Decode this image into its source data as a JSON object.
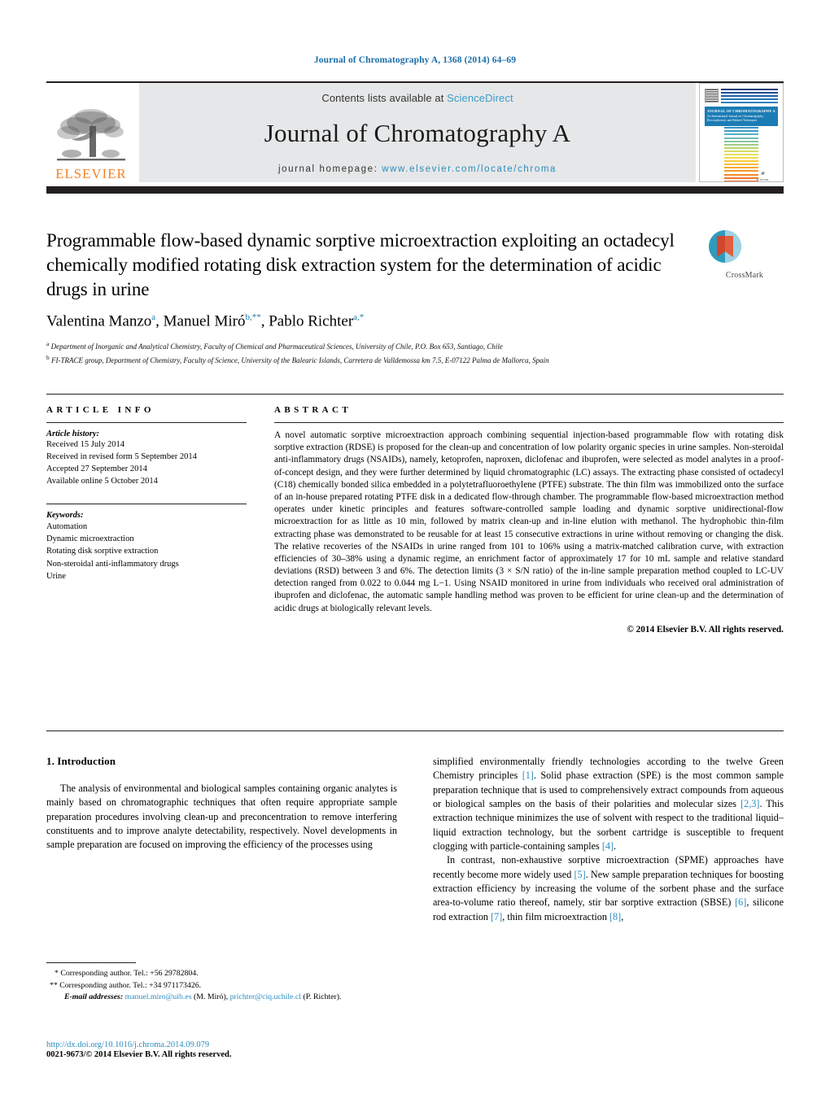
{
  "running_head": "Journal of Chromatography A, 1368 (2014) 64–69",
  "masthead": {
    "contents_prefix": "Contents lists available at ",
    "sciencedirect": "ScienceDirect",
    "journal_title": "Journal of Chromatography A",
    "homepage_prefix": "journal homepage: ",
    "homepage_url": "www.elsevier.com/locate/chroma",
    "publisher_wordmark": "ELSEVIER",
    "cover": {
      "band_title": "JOURNAL OF CHROMATOGRAPHY A",
      "band_sub": "An International Journal on Chromatography, Electrophoresis and Related Techniques",
      "publisher_note": "ELSEVIER"
    },
    "colors": {
      "link": "#2b8cbe",
      "elsevier_orange": "#f57f20",
      "masthead_grey": "#e6e7e8",
      "dark_band": "#231f20",
      "cover_band_blue": "#1b7cb5"
    }
  },
  "article": {
    "title": "Programmable flow-based dynamic sorptive microextraction exploiting an octadecyl chemically modified rotating disk extraction system for the determination of acidic drugs in urine",
    "authors": [
      {
        "name": "Valentina Manzo",
        "sup": "a"
      },
      {
        "name": "Manuel Miró",
        "sup": "b,**"
      },
      {
        "name": "Pablo Richter",
        "sup": "a,*"
      }
    ],
    "authors_line": "Valentina Manzo a, Manuel Miró b,**, Pablo Richter a,*",
    "affiliations": [
      {
        "marker": "a",
        "text": "Department of Inorganic and Analytical Chemistry, Faculty of Chemical and Pharmaceutical Sciences, University of Chile, P.O. Box 653, Santiago, Chile"
      },
      {
        "marker": "b",
        "text": "FI-TRACE group, Department of Chemistry, Faculty of Science, University of the Balearic Islands, Carretera de Valldemossa km 7.5, E-07122 Palma de Mallorca, Spain"
      }
    ],
    "crossmark_label": "CrossMark"
  },
  "article_info": {
    "heading": "ARTICLE INFO",
    "history_label": "Article history:",
    "history": [
      "Received 15 July 2014",
      "Received in revised form 5 September 2014",
      "Accepted 27 September 2014",
      "Available online 5 October 2014"
    ],
    "keywords_label": "Keywords:",
    "keywords": [
      "Automation",
      "Dynamic microextraction",
      "Rotating disk sorptive extraction",
      "Non-steroidal anti-inflammatory drugs",
      "Urine"
    ]
  },
  "abstract": {
    "heading": "ABSTRACT",
    "text": "A novel automatic sorptive microextraction approach combining sequential injection-based programmable flow with rotating disk sorptive extraction (RDSE) is proposed for the clean-up and concentration of low polarity organic species in urine samples. Non-steroidal anti-inflammatory drugs (NSAIDs), namely, ketoprofen, naproxen, diclofenac and ibuprofen, were selected as model analytes in a proof-of-concept design, and they were further determined by liquid chromatographic (LC) assays. The extracting phase consisted of octadecyl (C18) chemically bonded silica embedded in a polytetrafluoroethylene (PTFE) substrate. The thin film was immobilized onto the surface of an in-house prepared rotating PTFE disk in a dedicated flow-through chamber. The programmable flow-based microextraction method operates under kinetic principles and features software-controlled sample loading and dynamic sorptive unidirectional-flow microextraction for as little as 10 min, followed by matrix clean-up and in-line elution with methanol. The hydrophobic thin-film extracting phase was demonstrated to be reusable for at least 15 consecutive extractions in urine without removing or changing the disk. The relative recoveries of the NSAIDs in urine ranged from 101 to 106% using a matrix-matched calibration curve, with extraction efficiencies of 30–38% using a dynamic regime, an enrichment factor of approximately 17 for 10 mL sample and relative standard deviations (RSD) between 3 and 6%. The detection limits (3 × S/N ratio) of the in-line sample preparation method coupled to LC-UV detection ranged from 0.022 to 0.044 mg L−1. Using NSAID monitored in urine from individuals who received oral administration of ibuprofen and diclofenac, the automatic sample handling method was proven to be efficient for urine clean-up and the determination of acidic drugs at biologically relevant levels.",
    "copyright": "© 2014 Elsevier B.V. All rights reserved."
  },
  "body": {
    "section_number_title": "1.  Introduction",
    "left_paragraph_1": "The analysis of environmental and biological samples containing organic analytes is mainly based on chromatographic techniques that often require appropriate sample preparation procedures involving clean-up and preconcentration to remove interfering constituents and to improve analyte detectability, respectively. Novel developments in sample preparation are focused on improving the efficiency of the processes using",
    "right_paragraph_1_a": "simplified environmentally friendly technologies according to the twelve Green Chemistry principles ",
    "right_ref_1": "[1]",
    "right_paragraph_1_b": ". Solid phase extraction (SPE) is the most common sample preparation technique that is used to comprehensively extract compounds from aqueous or biological samples on the basis of their polarities and molecular sizes ",
    "right_ref_23": "[2,3]",
    "right_paragraph_1_c": ". This extraction technique minimizes the use of solvent with respect to the traditional liquid–liquid extraction technology, but the sorbent cartridge is susceptible to frequent clogging with particle-containing samples ",
    "right_ref_4": "[4]",
    "right_paragraph_1_d": ".",
    "right_paragraph_2_a": "In contrast, non-exhaustive sorptive microextraction (SPME) approaches have recently become more widely used ",
    "right_ref_5": "[5]",
    "right_paragraph_2_b": ". New sample preparation techniques for boosting extraction efficiency by increasing the volume of the sorbent phase and the surface area-to-volume ratio thereof, namely, stir bar sorptive extraction (SBSE) ",
    "right_ref_6": "[6]",
    "right_paragraph_2_c": ", silicone rod extraction ",
    "right_ref_7": "[7]",
    "right_paragraph_2_d": ", thin film microextraction ",
    "right_ref_8": "[8]",
    "right_paragraph_2_e": ","
  },
  "footnotes": {
    "corresponding_1": "* Corresponding author. Tel.: +56 29782804.",
    "corresponding_2": "** Corresponding author. Tel.: +34 971173426.",
    "email_label": "E-mail addresses:",
    "email_1": "manuel.miro@uib.es",
    "email_1_owner": "(M. Miró),",
    "email_2": "prichter@ciq.uchile.cl",
    "email_2_owner": "(P. Richter)."
  },
  "footer": {
    "doi": "http://dx.doi.org/10.1016/j.chroma.2014.09.079",
    "issn_line": "0021-9673/© 2014 Elsevier B.V. All rights reserved."
  }
}
